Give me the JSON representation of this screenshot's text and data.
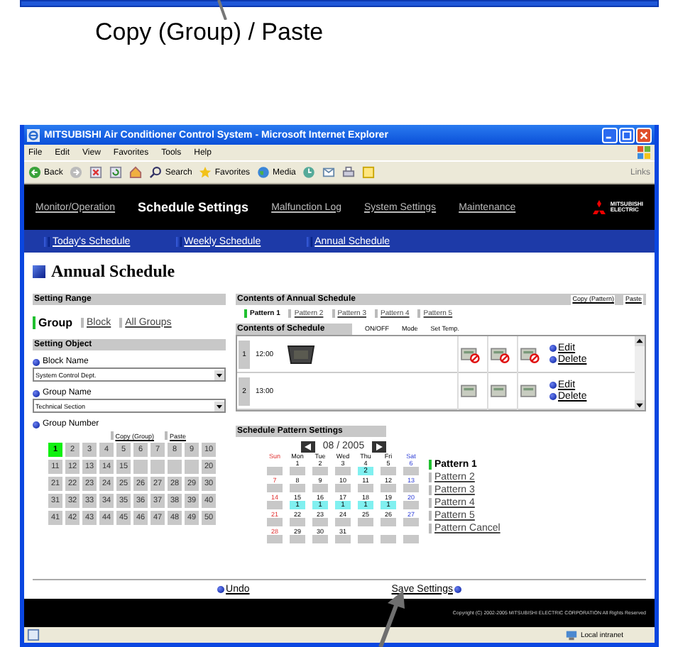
{
  "caption": "Copy (Group) / Paste",
  "window": {
    "title": "MITSUBISHI Air Conditioner Control System - Microsoft Internet Explorer"
  },
  "menu": [
    "File",
    "Edit",
    "View",
    "Favorites",
    "Tools",
    "Help"
  ],
  "toolbar": {
    "back": "Back",
    "search": "Search",
    "favorites": "Favorites",
    "media": "Media",
    "links": "Links"
  },
  "nav": [
    {
      "label": "Monitor/Operation",
      "selected": false
    },
    {
      "label": "Schedule Settings",
      "selected": true
    },
    {
      "label": "Malfunction Log",
      "selected": false
    },
    {
      "label": "System Settings",
      "selected": false
    },
    {
      "label": "Maintenance",
      "selected": false
    }
  ],
  "logo": [
    "MITSUBISHI",
    "ELECTRIC"
  ],
  "subnav": [
    "Today's Schedule",
    "Weekly Schedule",
    "Annual Schedule"
  ],
  "page_title": "Annual Schedule",
  "setting_range": {
    "heading": "Setting Range",
    "options": [
      {
        "label": "Group",
        "selected": true
      },
      {
        "label": "Block",
        "selected": false
      },
      {
        "label": "All Groups",
        "selected": false
      }
    ]
  },
  "setting_object": {
    "heading": "Setting Object",
    "block_label": "Block Name",
    "block_value": "System Control Dept.",
    "group_label": "Group Name",
    "group_value": "Technical Section",
    "number_label": "Group Number",
    "copy": "Copy (Group)",
    "paste": "Paste",
    "groups": [
      {
        "kind": "number",
        "label": "1",
        "selected": true
      },
      {
        "kind": "number",
        "label": "2",
        "selected": false
      },
      {
        "kind": "number",
        "label": "3",
        "selected": false
      },
      {
        "kind": "number",
        "label": "4",
        "selected": false
      },
      {
        "kind": "number",
        "label": "5",
        "selected": false
      },
      {
        "kind": "number",
        "label": "6",
        "selected": false
      },
      {
        "kind": "number",
        "label": "7",
        "selected": false
      },
      {
        "kind": "number",
        "label": "8",
        "selected": false
      },
      {
        "kind": "number",
        "label": "9",
        "selected": false
      },
      {
        "kind": "number",
        "label": "10",
        "selected": false
      },
      {
        "kind": "number",
        "label": "11",
        "selected": false
      },
      {
        "kind": "number",
        "label": "12",
        "selected": false
      },
      {
        "kind": "number",
        "label": "13",
        "selected": false
      },
      {
        "kind": "number",
        "label": "14",
        "selected": false
      },
      {
        "kind": "number",
        "label": "15",
        "selected": false
      },
      {
        "kind": "empty"
      },
      {
        "kind": "empty"
      },
      {
        "kind": "empty"
      },
      {
        "kind": "empty"
      },
      {
        "kind": "number",
        "label": "20",
        "selected": false
      },
      {
        "kind": "number",
        "label": "21",
        "selected": false
      },
      {
        "kind": "number",
        "label": "22",
        "selected": false
      },
      {
        "kind": "number",
        "label": "23",
        "selected": false
      },
      {
        "kind": "number",
        "label": "24",
        "selected": false
      },
      {
        "kind": "number",
        "label": "25",
        "selected": false
      },
      {
        "kind": "number",
        "label": "26",
        "selected": false
      },
      {
        "kind": "number",
        "label": "27",
        "selected": false
      },
      {
        "kind": "number",
        "label": "28",
        "selected": false
      },
      {
        "kind": "number",
        "label": "29",
        "selected": false
      },
      {
        "kind": "number",
        "label": "30",
        "selected": false
      },
      {
        "kind": "number",
        "label": "31",
        "selected": false
      },
      {
        "kind": "number",
        "label": "32",
        "selected": false
      },
      {
        "kind": "number",
        "label": "33",
        "selected": false
      },
      {
        "kind": "number",
        "label": "34",
        "selected": false
      },
      {
        "kind": "number",
        "label": "35",
        "selected": false
      },
      {
        "kind": "number",
        "label": "36",
        "selected": false
      },
      {
        "kind": "number",
        "label": "37",
        "selected": false
      },
      {
        "kind": "number",
        "label": "38",
        "selected": false
      },
      {
        "kind": "number",
        "label": "39",
        "selected": false
      },
      {
        "kind": "number",
        "label": "40",
        "selected": false
      },
      {
        "kind": "number",
        "label": "41",
        "selected": false
      },
      {
        "kind": "number",
        "label": "42",
        "selected": false
      },
      {
        "kind": "number",
        "label": "43",
        "selected": false
      },
      {
        "kind": "number",
        "label": "44",
        "selected": false
      },
      {
        "kind": "number",
        "label": "45",
        "selected": false
      },
      {
        "kind": "number",
        "label": "46",
        "selected": false
      },
      {
        "kind": "number",
        "label": "47",
        "selected": false
      },
      {
        "kind": "number",
        "label": "48",
        "selected": false
      },
      {
        "kind": "number",
        "label": "49",
        "selected": false
      },
      {
        "kind": "number",
        "label": "50",
        "selected": false
      }
    ]
  },
  "contents": {
    "heading": "Contents of Annual Schedule",
    "copy": "Copy (Pattern)",
    "paste": "Paste",
    "patterns": [
      {
        "label": "Pattern 1",
        "selected": true
      },
      {
        "label": "Pattern 2",
        "selected": false
      },
      {
        "label": "Pattern 3",
        "selected": false
      },
      {
        "label": "Pattern 4",
        "selected": false
      },
      {
        "label": "Pattern 5",
        "selected": false
      }
    ]
  },
  "schedule": {
    "heading": "Contents of Schedule",
    "columns": [
      "ON/OFF",
      "Mode",
      "Set Temp."
    ],
    "rows": [
      {
        "no": "1",
        "time": "12:00",
        "unit": true,
        "edit": "Edit",
        "delete": "Delete",
        "cells": [
          {
            "prohibited": true
          },
          {
            "prohibited": true
          },
          {
            "prohibited": true
          }
        ]
      },
      {
        "no": "2",
        "time": "13:00",
        "unit": false,
        "edit": "Edit",
        "delete": "Delete",
        "cells": [
          {
            "prohibited": false
          },
          {
            "prohibited": false
          },
          {
            "prohibited": false
          }
        ]
      }
    ]
  },
  "pattern_settings": {
    "heading": "Schedule Pattern Settings",
    "month": "08 / 2005",
    "weekdays": [
      {
        "label": "Sun",
        "kind": "sunday"
      },
      {
        "label": "Mon",
        "kind": "weekday"
      },
      {
        "label": "Tue",
        "kind": "weekday"
      },
      {
        "label": "Wed",
        "kind": "weekday"
      },
      {
        "label": "Thu",
        "kind": "weekday"
      },
      {
        "label": "Fri",
        "kind": "weekday"
      },
      {
        "label": "Sat",
        "kind": "saturday"
      }
    ],
    "days": [
      {
        "kind": "blank"
      },
      {
        "kind": "day",
        "date": "1"
      },
      {
        "kind": "day",
        "date": "2"
      },
      {
        "kind": "day",
        "date": "3"
      },
      {
        "kind": "day",
        "date": "4",
        "pattern": "2"
      },
      {
        "kind": "day",
        "date": "5"
      },
      {
        "kind": "day",
        "date": "6"
      },
      {
        "kind": "day",
        "date": "7"
      },
      {
        "kind": "day",
        "date": "8"
      },
      {
        "kind": "day",
        "date": "9"
      },
      {
        "kind": "day",
        "date": "10"
      },
      {
        "kind": "day",
        "date": "11"
      },
      {
        "kind": "day",
        "date": "12"
      },
      {
        "kind": "day",
        "date": "13"
      },
      {
        "kind": "day",
        "date": "14"
      },
      {
        "kind": "day",
        "date": "15",
        "pattern": "1"
      },
      {
        "kind": "day",
        "date": "16",
        "pattern": "1"
      },
      {
        "kind": "day",
        "date": "17",
        "pattern": "1"
      },
      {
        "kind": "day",
        "date": "18",
        "pattern": "1"
      },
      {
        "kind": "day",
        "date": "19",
        "pattern": "1"
      },
      {
        "kind": "day",
        "date": "20"
      },
      {
        "kind": "day",
        "date": "21"
      },
      {
        "kind": "day",
        "date": "22"
      },
      {
        "kind": "day",
        "date": "23"
      },
      {
        "kind": "day",
        "date": "24"
      },
      {
        "kind": "day",
        "date": "25"
      },
      {
        "kind": "day",
        "date": "26"
      },
      {
        "kind": "day",
        "date": "27"
      },
      {
        "kind": "day",
        "date": "28"
      },
      {
        "kind": "day",
        "date": "29"
      },
      {
        "kind": "day",
        "date": "30"
      },
      {
        "kind": "day",
        "date": "31"
      },
      {
        "kind": "blank"
      },
      {
        "kind": "blank"
      },
      {
        "kind": "blank"
      }
    ],
    "patterns": [
      {
        "label": "Pattern 1",
        "selected": true
      },
      {
        "label": "Pattern 2",
        "selected": false
      },
      {
        "label": "Pattern 3",
        "selected": false
      },
      {
        "label": "Pattern 4",
        "selected": false
      },
      {
        "label": "Pattern 5",
        "selected": false
      },
      {
        "label": "Pattern Cancel",
        "selected": false
      }
    ]
  },
  "undo": "Undo",
  "save": "Save Settings",
  "copyright": "Copyright (C) 2002-2005 MITSUBISHI ELECTRIC CORPORATION All Rights Reserved",
  "status": "Local intranet"
}
